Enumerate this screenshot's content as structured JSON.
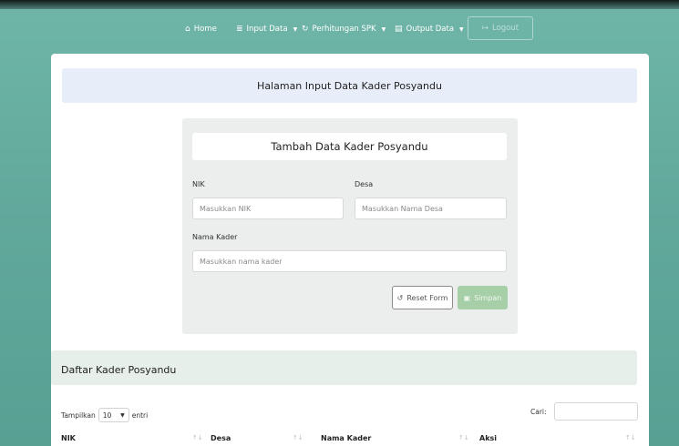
{
  "nav": {
    "home": "Home",
    "input": "Input Data",
    "perhitungan": "Perhitungan SPK",
    "output": "Output Data",
    "logout": "Logout"
  },
  "page": {
    "title": "Halaman Input Data Kader Posyandu"
  },
  "form": {
    "heading": "Tambah Data Kader Posyandu",
    "nik_label": "NIK",
    "nik_placeholder": "Masukkan NIK",
    "desa_label": "Desa",
    "desa_placeholder": "Masukkan Nama Desa",
    "nama_label": "Nama Kader",
    "nama_placeholder": "Masukkan nama kader",
    "reset": "Reset Form",
    "save": "Simpan"
  },
  "list": {
    "title": "Daftar Kader Posyandu",
    "show_prefix": "Tampilkan",
    "show_value": "10",
    "show_suffix": "entri",
    "search_label": "Cari:",
    "columns": [
      "NIK",
      "Desa",
      "Nama Kader",
      "Aksi"
    ]
  },
  "colors": {
    "background": "#62a99c",
    "save_button": "#a6cfa7",
    "title_bar": "#e8eef9"
  },
  "icons": {
    "home": "home-icon",
    "input": "database-icon",
    "perhitungan": "refresh-icon",
    "output": "file-icon",
    "logout": "logout-icon",
    "reset": "undo-icon",
    "save": "save-icon"
  }
}
